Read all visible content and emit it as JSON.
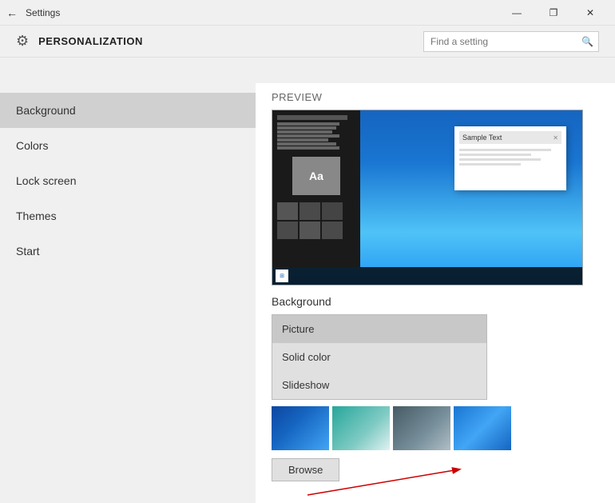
{
  "titleBar": {
    "title": "Settings",
    "controls": {
      "minimize": "—",
      "maximize": "❐",
      "close": "✕"
    }
  },
  "header": {
    "appTitle": "PERSONALIZATION",
    "search": {
      "placeholder": "Find a setting",
      "icon": "🔍"
    }
  },
  "sidebar": {
    "items": [
      {
        "id": "background",
        "label": "Background",
        "active": true
      },
      {
        "id": "colors",
        "label": "Colors",
        "active": false
      },
      {
        "id": "lock-screen",
        "label": "Lock screen",
        "active": false
      },
      {
        "id": "themes",
        "label": "Themes",
        "active": false
      },
      {
        "id": "start",
        "label": "Start",
        "active": false
      }
    ]
  },
  "content": {
    "previewLabel": "Preview",
    "sampleText": "Sample Text",
    "aaLabel": "Aa",
    "backgroundLabel": "Background",
    "dropdownOptions": [
      {
        "label": "Picture",
        "selected": false
      },
      {
        "label": "Solid color",
        "selected": false
      },
      {
        "label": "Slideshow",
        "selected": false
      }
    ],
    "browseLabel": "Browse"
  }
}
